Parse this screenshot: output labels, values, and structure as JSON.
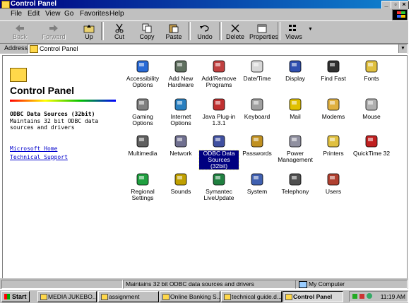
{
  "window": {
    "title": "Control Panel"
  },
  "menu": [
    "File",
    "Edit",
    "View",
    "Go",
    "Favorites",
    "Help"
  ],
  "toolbar": [
    {
      "label": "Back",
      "icon": "back-arrow-icon",
      "enabled": false
    },
    {
      "label": "Forward",
      "icon": "forward-arrow-icon",
      "enabled": false
    },
    {
      "label": "Up",
      "icon": "up-folder-icon",
      "enabled": true
    },
    {
      "label": "Cut",
      "icon": "scissors-icon",
      "enabled": true
    },
    {
      "label": "Copy",
      "icon": "copy-icon",
      "enabled": true
    },
    {
      "label": "Paste",
      "icon": "paste-icon",
      "enabled": true
    },
    {
      "label": "Undo",
      "icon": "undo-icon",
      "enabled": true
    },
    {
      "label": "Delete",
      "icon": "delete-x-icon",
      "enabled": true
    },
    {
      "label": "Properties",
      "icon": "properties-icon",
      "enabled": true
    },
    {
      "label": "Views",
      "icon": "views-icon",
      "enabled": true
    }
  ],
  "address": {
    "label": "Address",
    "value": "Control Panel"
  },
  "left_pane": {
    "title": "Control Panel",
    "selected_name": "ODBC Data Sources (32bit)",
    "selected_desc": "Maintains 32 bit ODBC data sources and drivers",
    "links": [
      "Microsoft Home",
      "Technical Support"
    ]
  },
  "items": [
    {
      "label": "Accessibility Options",
      "icon": "accessibility-icon"
    },
    {
      "label": "Add New Hardware",
      "icon": "hardware-icon"
    },
    {
      "label": "Add/Remove Programs",
      "icon": "programs-icon"
    },
    {
      "label": "Date/Time",
      "icon": "calendar-clock-icon"
    },
    {
      "label": "Display",
      "icon": "display-icon"
    },
    {
      "label": "Find Fast",
      "icon": "binoculars-icon"
    },
    {
      "label": "Fonts",
      "icon": "fonts-folder-icon"
    },
    {
      "label": "Gaming Options",
      "icon": "joystick-icon"
    },
    {
      "label": "Internet Options",
      "icon": "globe-icon"
    },
    {
      "label": "Java Plug-in 1.3.1",
      "icon": "java-icon"
    },
    {
      "label": "Keyboard",
      "icon": "keyboard-icon"
    },
    {
      "label": "Mail",
      "icon": "mail-icon"
    },
    {
      "label": "Modems",
      "icon": "modem-icon"
    },
    {
      "label": "Mouse",
      "icon": "mouse-icon"
    },
    {
      "label": "Multimedia",
      "icon": "multimedia-icon"
    },
    {
      "label": "Network",
      "icon": "network-icon"
    },
    {
      "label": "ODBC Data Sources (32bit)",
      "icon": "odbc-icon",
      "selected": true
    },
    {
      "label": "Passwords",
      "icon": "keys-icon"
    },
    {
      "label": "Power Management",
      "icon": "power-icon"
    },
    {
      "label": "Printers",
      "icon": "printer-folder-icon"
    },
    {
      "label": "QuickTime 32",
      "icon": "quicktime-icon"
    },
    {
      "label": "Regional Settings",
      "icon": "regional-globe-icon"
    },
    {
      "label": "Sounds",
      "icon": "speaker-icon"
    },
    {
      "label": "Symantec LiveUpdate",
      "icon": "liveupdate-icon"
    },
    {
      "label": "System",
      "icon": "computer-icon"
    },
    {
      "label": "Telephony",
      "icon": "telephone-icon"
    },
    {
      "label": "Users",
      "icon": "users-icon"
    }
  ],
  "status": {
    "text": "Maintains 32 bit ODBC data sources and drivers",
    "zone": "My Computer"
  },
  "taskbar": {
    "start": "Start",
    "tasks": [
      {
        "label": "MEDIA JUKEBO...",
        "active": false
      },
      {
        "label": "assignment",
        "active": false
      },
      {
        "label": "Online Banking S...",
        "active": false
      },
      {
        "label": "technical guide.d...",
        "active": false
      },
      {
        "label": "Control Panel",
        "active": true
      }
    ],
    "clock": "11:19 AM"
  },
  "colors": {
    "titlebar": "#000080",
    "face": "#c0c0c0",
    "selection": "#000080",
    "link": "#0000cc"
  }
}
